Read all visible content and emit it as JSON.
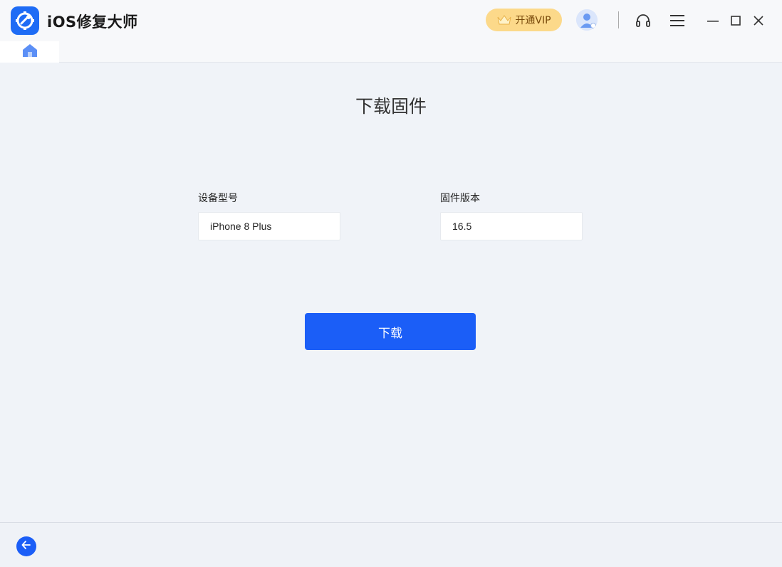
{
  "app": {
    "title": "iOS修复大师",
    "logo_icon": "wrench-gear-icon",
    "accent_color": "#1b5ef7"
  },
  "titlebar": {
    "vip_label": "开通VIP",
    "vip_icon": "crown-icon",
    "avatar_icon": "user-avatar-icon",
    "support_icon": "headset-icon",
    "menu_icon": "hamburger-menu-icon",
    "minimize_icon": "minimize-icon",
    "maximize_icon": "maximize-icon",
    "close_icon": "close-icon"
  },
  "tabs": {
    "home_icon": "home-icon"
  },
  "main": {
    "title": "下载固件",
    "device_label": "设备型号",
    "device_value": "iPhone 8 Plus",
    "firmware_label": "固件版本",
    "firmware_value": "16.5",
    "download_label": "下载"
  },
  "footer": {
    "back_icon": "arrow-left-icon"
  }
}
